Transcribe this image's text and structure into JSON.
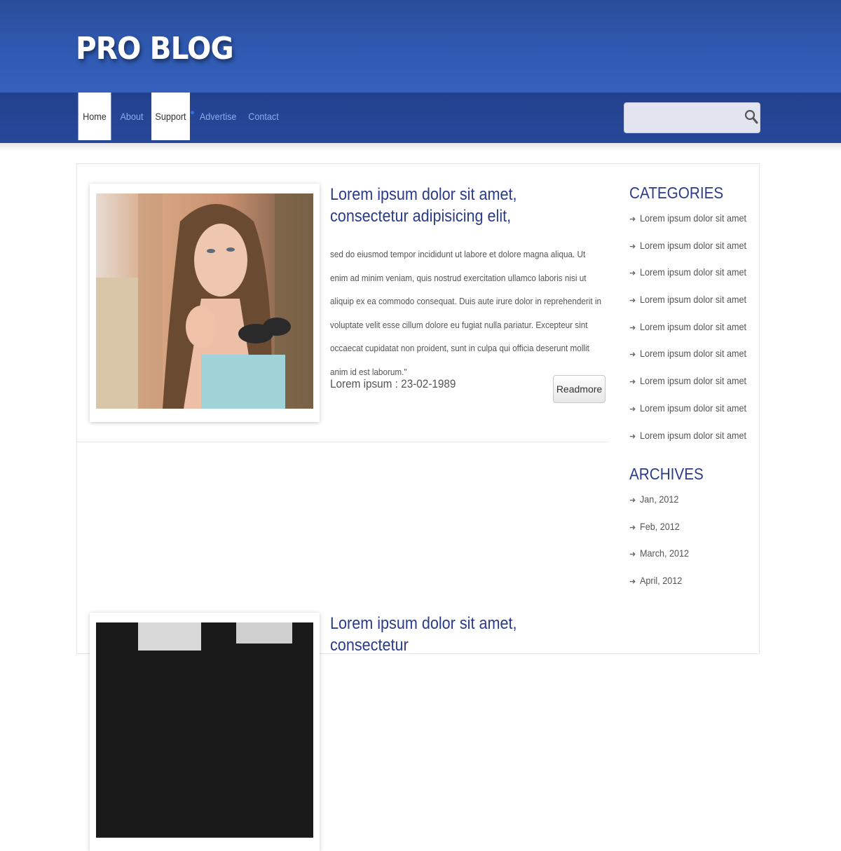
{
  "header": {
    "logo": "PRO BLOG"
  },
  "nav": {
    "items": [
      {
        "label": "Home"
      },
      {
        "label": "About"
      },
      {
        "label": "Support"
      },
      {
        "label": "Advertise"
      },
      {
        "label": "Contact"
      }
    ]
  },
  "search": {
    "value": "",
    "placeholder": ""
  },
  "posts": [
    {
      "title": "Lorem ipsum dolor sit amet, consectetur adipisicing elit,",
      "body": "sed do eiusmod tempor incididunt ut labore et dolore magna aliqua. Ut enim ad minim veniam, quis nostrud exercitation ullamco laboris nisi ut aliquip ex ea commodo consequat. Duis aute irure dolor in reprehenderit in voluptate velit esse cillum dolore eu fugiat nulla pariatur. Excepteur sint occaecat cupidatat non proident, sunt in culpa qui officia deserunt mollit anim id est laborum.\"",
      "meta": "Lorem ipsum : 23-02-1989",
      "readmore": "Readmore"
    },
    {
      "title": "Lorem ipsum dolor sit amet, consectetur"
    }
  ],
  "sidebar": {
    "categories_title": "CATEGORIES",
    "categories": [
      "Lorem ipsum dolor sit amet",
      "Lorem ipsum dolor sit amet",
      "Lorem ipsum dolor sit amet",
      "Lorem ipsum dolor sit amet",
      "Lorem ipsum dolor sit amet",
      "Lorem ipsum dolor sit amet",
      "Lorem ipsum dolor sit amet",
      "Lorem ipsum dolor sit amet",
      "Lorem ipsum dolor sit amet"
    ],
    "archives_title": "ARCHIVES",
    "archives": [
      "Jan, 2012",
      "Feb, 2012",
      "March, 2012",
      "April, 2012"
    ]
  },
  "colors": {
    "header_blue": "#2f5ab2",
    "nav_blue": "#24449a",
    "title_blue": "#2a3b8a",
    "nav_link": "#8aaaf0"
  },
  "icons": {
    "search": "search-icon",
    "list_bullet": "arrow-right-icon"
  }
}
